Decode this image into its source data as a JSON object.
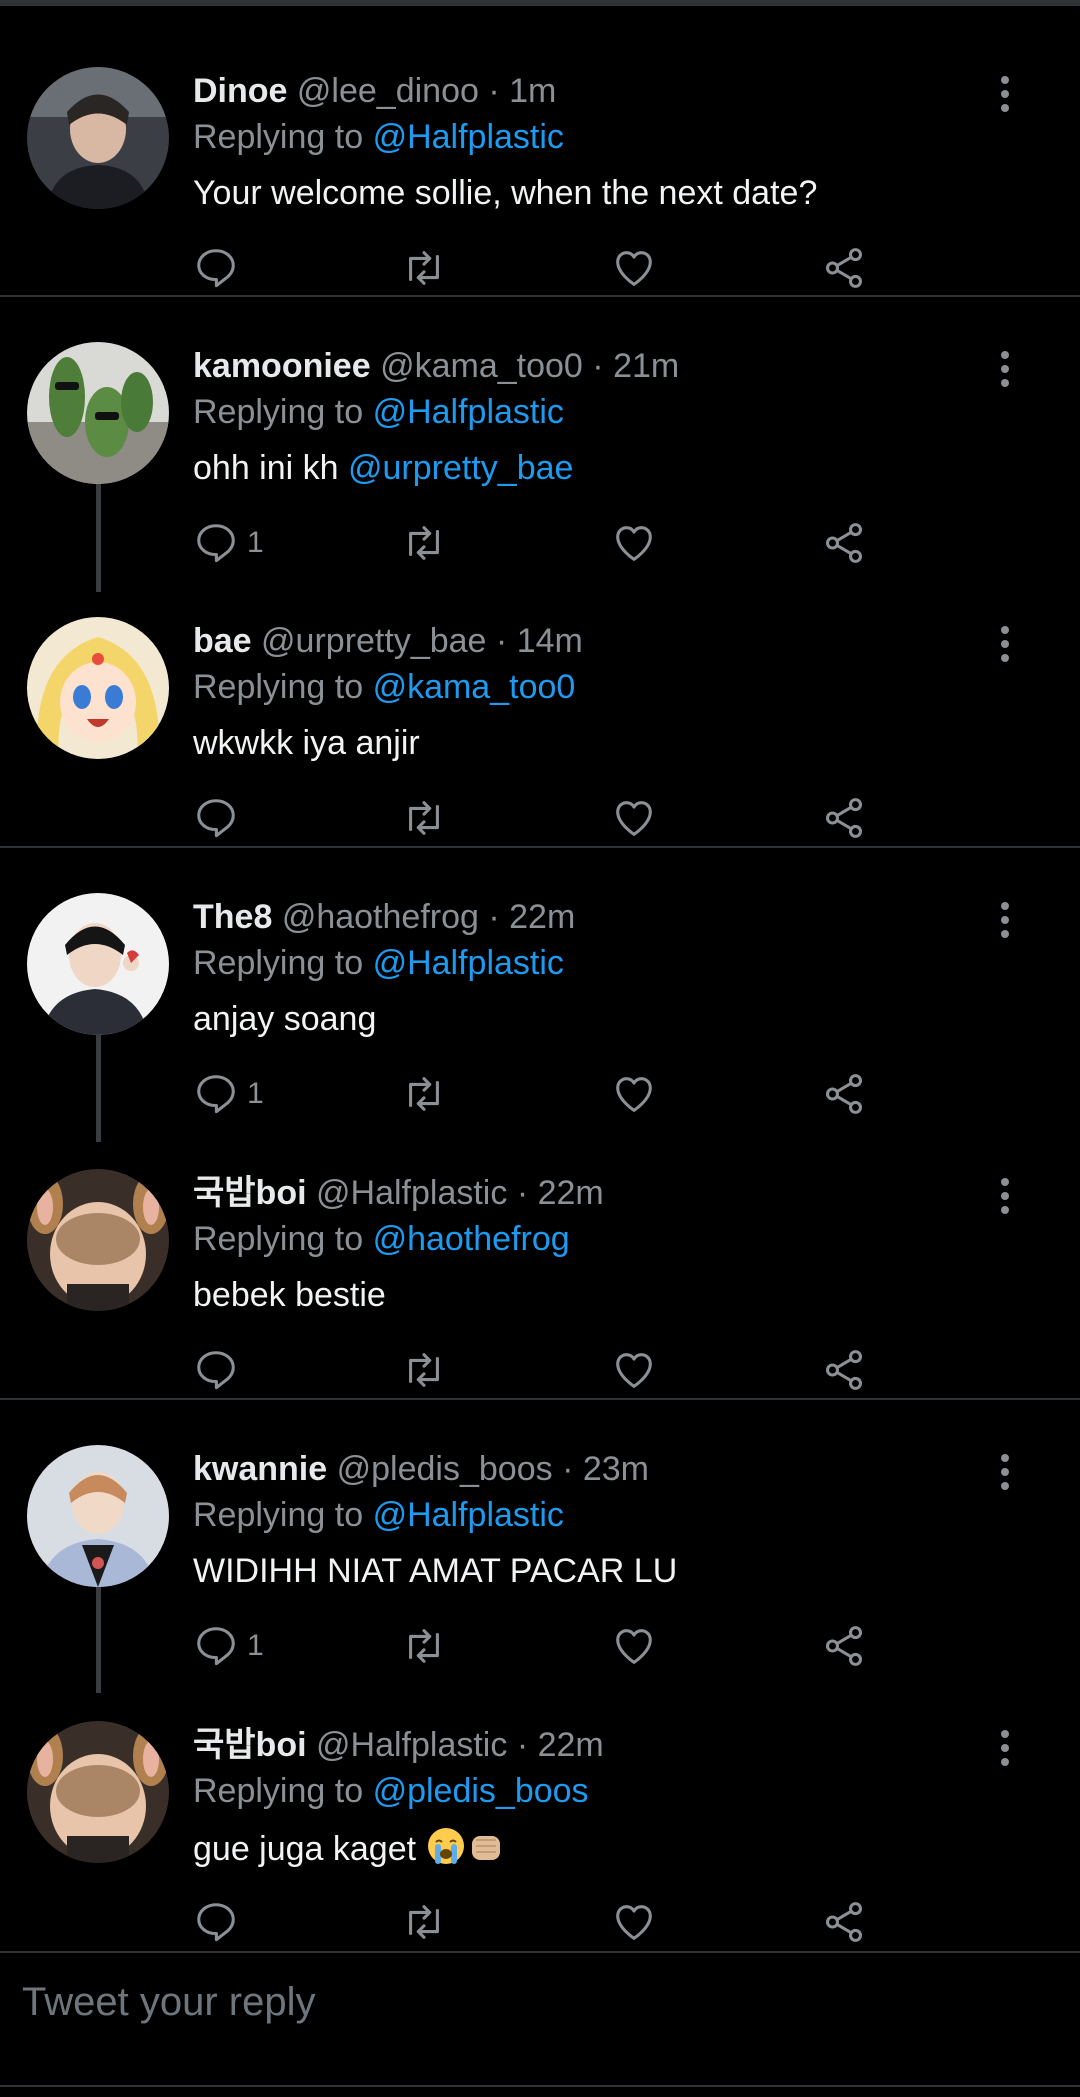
{
  "replies": [
    {
      "name": "Dinoe",
      "handle": "@lee_dinoo",
      "time": "1m",
      "replying_label": "Replying to",
      "replying_to": "@Halfplastic",
      "text": "Your welcome sollie, when the next date?",
      "reply_count": ""
    },
    {
      "name": "kamooniee",
      "handle": "@kama_too0",
      "time": "21m",
      "replying_label": "Replying to",
      "replying_to": "@Halfplastic",
      "text": "ohh ini kh",
      "text_mention": "@urpretty_bae",
      "reply_count": "1"
    },
    {
      "name": "bae",
      "handle": "@urpretty_bae",
      "time": "14m",
      "replying_label": "Replying to",
      "replying_to": "@kama_too0",
      "text": "wkwkk iya anjir",
      "reply_count": ""
    },
    {
      "name": "The8",
      "handle": "@haothefrog",
      "time": "22m",
      "replying_label": "Replying to",
      "replying_to": "@Halfplastic",
      "text": "anjay soang",
      "reply_count": "1"
    },
    {
      "name": "국밥boi",
      "handle": "@Halfplastic",
      "time": "22m",
      "replying_label": "Replying to",
      "replying_to": "@haothefrog",
      "text": "bebek bestie",
      "reply_count": ""
    },
    {
      "name": "kwannie",
      "handle": "@pledis_boos",
      "time": "23m",
      "replying_label": "Replying to",
      "replying_to": "@Halfplastic",
      "text": "WIDIHH NIAT AMAT PACAR LU",
      "reply_count": "1"
    },
    {
      "name": "국밥boi",
      "handle": "@Halfplastic",
      "time": "22m",
      "replying_label": "Replying to",
      "replying_to": "@pledis_boos",
      "text": "gue juga kaget",
      "reply_count": ""
    }
  ],
  "separator": "·",
  "compose": {
    "placeholder": "Tweet your reply"
  },
  "colors": {
    "background": "#000000",
    "mention": "#1d9bf0",
    "muted": "#8b9095",
    "divider": "#2f3336"
  },
  "icons": [
    "reply-icon",
    "retweet-icon",
    "like-icon",
    "share-icon",
    "more-icon",
    "crying-face-emoji",
    "fist-emoji"
  ]
}
